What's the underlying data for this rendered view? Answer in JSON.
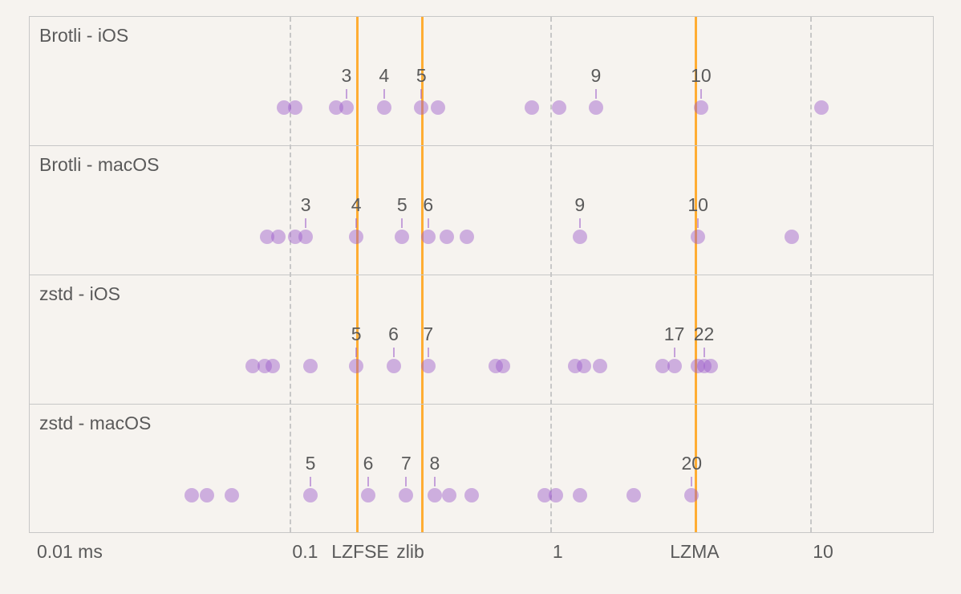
{
  "chart_data": {
    "type": "scatter",
    "xlabel": "",
    "ylabel": "",
    "x_scale": "log10",
    "x_unit": "ms",
    "x_range": [
      0.01,
      30
    ],
    "x_ticks": [
      {
        "value": 0.01,
        "label": "0.01 ms"
      },
      {
        "value": 0.1,
        "label": "0.1"
      },
      {
        "value": 1,
        "label": "1"
      },
      {
        "value": 10,
        "label": "10"
      }
    ],
    "reference_lines": [
      {
        "name": "LZFSE",
        "value": 0.18
      },
      {
        "name": "zlib",
        "value": 0.32
      },
      {
        "name": "LZMA",
        "value": 3.6
      }
    ],
    "rows": [
      {
        "name": "Brotli - iOS",
        "points": [
          {
            "x": 0.095
          },
          {
            "x": 0.105
          },
          {
            "x": 0.15
          },
          {
            "x": 0.165,
            "label": "3"
          },
          {
            "x": 0.23,
            "label": "4"
          },
          {
            "x": 0.32,
            "label": "5"
          },
          {
            "x": 0.37
          },
          {
            "x": 0.85
          },
          {
            "x": 1.08
          },
          {
            "x": 1.5,
            "label": "9"
          },
          {
            "x": 3.8,
            "label": "10"
          },
          {
            "x": 11.0
          }
        ]
      },
      {
        "name": "Brotli - macOS",
        "points": [
          {
            "x": 0.082
          },
          {
            "x": 0.09
          },
          {
            "x": 0.105
          },
          {
            "x": 0.115,
            "label": "3"
          },
          {
            "x": 0.18,
            "label": "4"
          },
          {
            "x": 0.27,
            "label": "5"
          },
          {
            "x": 0.34,
            "label": "6"
          },
          {
            "x": 0.4
          },
          {
            "x": 0.48
          },
          {
            "x": 1.3,
            "label": "9"
          },
          {
            "x": 3.7,
            "label": "10"
          },
          {
            "x": 8.5
          }
        ]
      },
      {
        "name": "zstd - iOS",
        "points": [
          {
            "x": 0.072
          },
          {
            "x": 0.08
          },
          {
            "x": 0.086
          },
          {
            "x": 0.12
          },
          {
            "x": 0.18,
            "label": "5"
          },
          {
            "x": 0.25,
            "label": "6"
          },
          {
            "x": 0.34,
            "label": "7"
          },
          {
            "x": 0.62
          },
          {
            "x": 0.66
          },
          {
            "x": 1.25
          },
          {
            "x": 1.35
          },
          {
            "x": 1.55
          },
          {
            "x": 2.7
          },
          {
            "x": 3.0,
            "label": "17"
          },
          {
            "x": 3.7
          },
          {
            "x": 3.9,
            "label": "22"
          },
          {
            "x": 4.15
          }
        ]
      },
      {
        "name": "zstd - macOS",
        "points": [
          {
            "x": 0.042
          },
          {
            "x": 0.048
          },
          {
            "x": 0.06
          },
          {
            "x": 0.12,
            "label": "5"
          },
          {
            "x": 0.2,
            "label": "6"
          },
          {
            "x": 0.28,
            "label": "7"
          },
          {
            "x": 0.36,
            "label": "8"
          },
          {
            "x": 0.41
          },
          {
            "x": 0.5
          },
          {
            "x": 0.95
          },
          {
            "x": 1.05
          },
          {
            "x": 1.3
          },
          {
            "x": 2.1
          },
          {
            "x": 3.5,
            "label": "20"
          }
        ]
      }
    ]
  }
}
